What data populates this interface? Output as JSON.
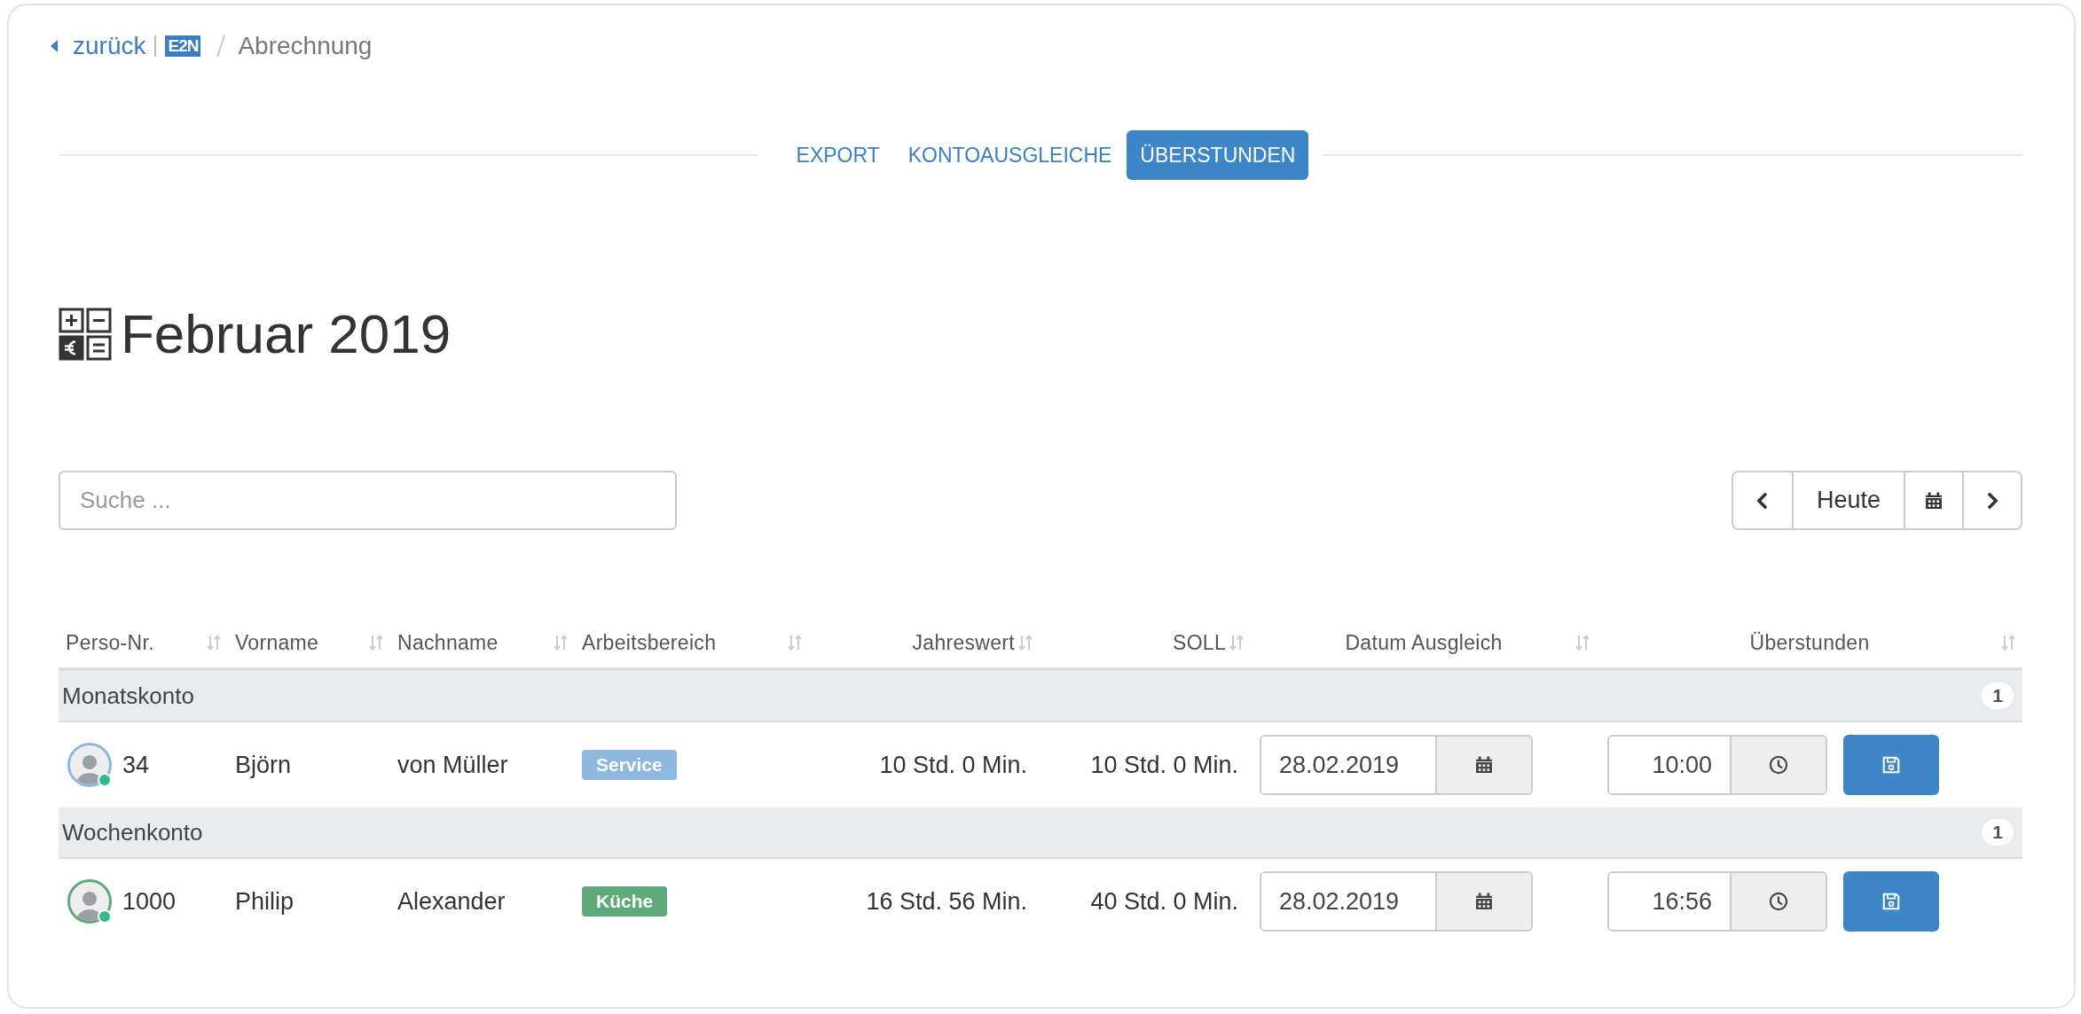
{
  "breadcrumb": {
    "back": "zurück",
    "logo": "E2N",
    "current": "Abrechnung"
  },
  "tabs": [
    {
      "label": "EXPORT",
      "selected": false
    },
    {
      "label": "KONTOAUSGLEICHE",
      "selected": false
    },
    {
      "label": "ÜBERSTUNDEN",
      "selected": true
    }
  ],
  "title": "Februar 2019",
  "search": {
    "placeholder": "Suche ..."
  },
  "date_nav": {
    "today": "Heute"
  },
  "table": {
    "columns": [
      "Perso-Nr.",
      "Vorname",
      "Nachname",
      "Arbeitsbereich",
      "Jahreswert",
      "SOLL",
      "Datum Ausgleich",
      "Überstunden"
    ],
    "groups": [
      {
        "name": "Monatskonto",
        "count": "1",
        "rows": [
          {
            "perso_nr": "34",
            "first_name": "Björn",
            "last_name": "von Müller",
            "online": true,
            "area": {
              "label": "Service",
              "color": "#8fb8e0"
            },
            "jahreswert": "10 Std. 0 Min.",
            "soll": "10 Std. 0 Min.",
            "date": "28.02.2019",
            "overtime": "10:00"
          }
        ]
      },
      {
        "name": "Wochenkonto",
        "count": "1",
        "rows": [
          {
            "perso_nr": "1000",
            "first_name": "Philip",
            "last_name": "Alexander",
            "online": true,
            "area": {
              "label": "Küche",
              "color": "#5fa97a"
            },
            "jahreswert": "16 Std. 56 Min.",
            "soll": "40 Std. 0 Min.",
            "date": "28.02.2019",
            "overtime": "16:56"
          }
        ]
      }
    ]
  }
}
